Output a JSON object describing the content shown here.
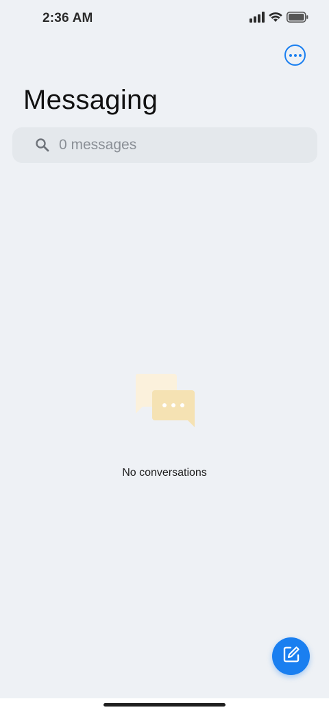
{
  "status_bar": {
    "time": "2:36 AM",
    "icons": [
      "cellular-signal-icon",
      "wifi-icon",
      "battery-icon"
    ]
  },
  "header": {
    "title": "Messaging",
    "more_icon": "more-options-icon"
  },
  "search": {
    "placeholder": "0 messages",
    "icon": "search-icon"
  },
  "empty_state": {
    "illustration": "chat-bubbles-icon",
    "text": "No conversations"
  },
  "fab": {
    "icon": "compose-icon"
  },
  "colors": {
    "background": "#eef1f5",
    "accent": "#1a7ff0",
    "search_bg": "#e4e8ec"
  }
}
